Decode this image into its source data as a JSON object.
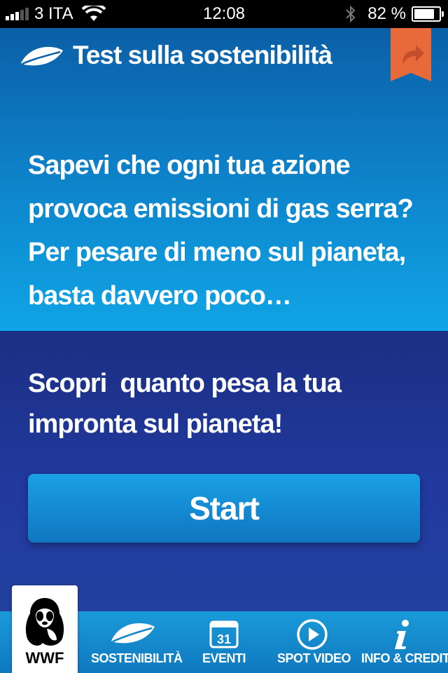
{
  "status_bar": {
    "carrier": "3 ITA",
    "time": "12:08",
    "battery_percent": "82 %",
    "battery_level": 0.82
  },
  "header": {
    "title": "Test sulla sostenibilità",
    "logo_icon": "leaf-icon",
    "share_icon": "share-arrow-icon"
  },
  "intro": {
    "lines": [
      "Sapevi che ogni tua azione",
      "provoca emissioni di gas serra?",
      "Per pesare di meno sul pianeta,",
      "basta davvero poco…"
    ]
  },
  "cta": {
    "lines": [
      "Scopri  quanto pesa la tua",
      "impronta sul pianeta!"
    ]
  },
  "start_button": {
    "label": "Start"
  },
  "tab_bar": {
    "brand_label": "WWF",
    "tabs": [
      {
        "label": "SOSTENIBILITÀ",
        "icon": "leaf-icon"
      },
      {
        "label": "EVENTI",
        "icon": "calendar-icon",
        "icon_text": "31"
      },
      {
        "label": "SPOT VIDEO",
        "icon": "play-icon"
      },
      {
        "label": "INFO & CREDITI",
        "icon": "info-icon"
      }
    ]
  },
  "colors": {
    "accent_orange": "#e8693a",
    "top_panel_blue": "#0d7cc4",
    "dark_blue": "#1f3a8f",
    "button_blue": "#1aa0e4"
  }
}
